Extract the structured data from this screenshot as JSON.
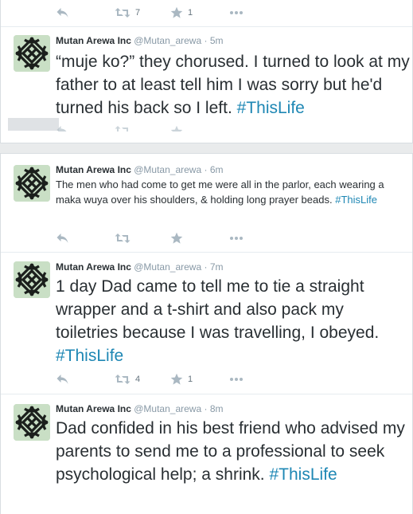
{
  "colors": {
    "accent": "#1e87b4",
    "muted": "#8899a6",
    "text": "#292f33",
    "avatar_bg": "#c9dfc5"
  },
  "top_actions": {
    "retweet_count": "7",
    "favorite_count": "1"
  },
  "tweets": [
    {
      "author": "Mutan Arewa Inc",
      "handle": "@Mutan_arewa",
      "separator": "·",
      "time": "5m",
      "text": "“muje ko?” they chorused. I turned to look at my father to at least tell him I was sorry but he'd turned his back so I left.",
      "hashtag": "#ThisLife",
      "retweet_count": "",
      "favorite_count": ""
    },
    {
      "author": "Mutan Arewa Inc",
      "handle": "@Mutan_arewa",
      "separator": "·",
      "time": "6m",
      "text": "The men who had come to get me were all in the parlor, each wearing a maka wuya over his shoulders, & holding long prayer beads.",
      "hashtag": "#ThisLife",
      "retweet_count": "",
      "favorite_count": ""
    },
    {
      "author": "Mutan Arewa Inc",
      "handle": "@Mutan_arewa",
      "separator": "·",
      "time": "7m",
      "text": "1 day Dad came to tell me to tie a straight wrapper and a t-shirt and also pack my toiletries because I was travelling, I obeyed.",
      "hashtag": "#ThisLife",
      "retweet_count": "4",
      "favorite_count": "1"
    },
    {
      "author": "Mutan Arewa Inc",
      "handle": "@Mutan_arewa",
      "separator": "·",
      "time": "8m",
      "text": "Dad confided in his best friend who advised my parents to send me to a professional to seek psychological help; a shrink.",
      "hashtag": "#ThisLife",
      "retweet_count": "",
      "favorite_count": ""
    }
  ]
}
